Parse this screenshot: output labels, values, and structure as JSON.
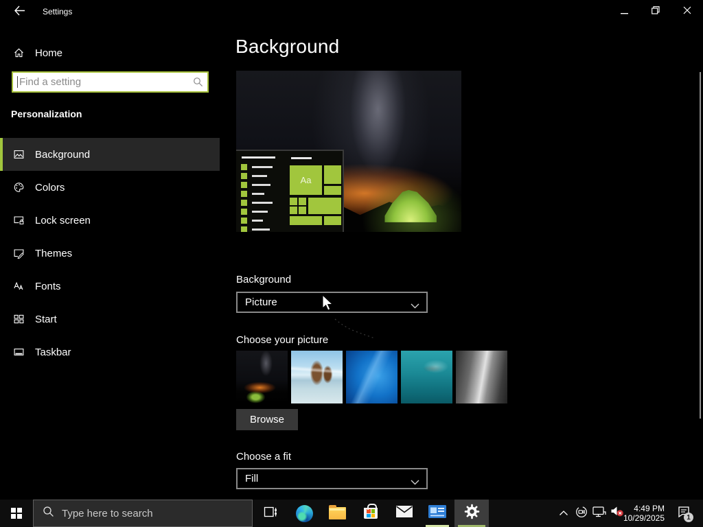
{
  "colors": {
    "accent": "#a1c63d",
    "selected_row_bg": "#272727",
    "running_underline": "#c6dc96"
  },
  "window": {
    "title": "Settings"
  },
  "sidebar": {
    "home_label": "Home",
    "search": {
      "placeholder": "Find a setting"
    },
    "section_heading": "Personalization",
    "items": [
      {
        "label": "Background",
        "selected": true
      },
      {
        "label": "Colors",
        "selected": false
      },
      {
        "label": "Lock screen",
        "selected": false
      },
      {
        "label": "Themes",
        "selected": false
      },
      {
        "label": "Fonts",
        "selected": false
      },
      {
        "label": "Start",
        "selected": false
      },
      {
        "label": "Taskbar",
        "selected": false
      }
    ]
  },
  "main": {
    "heading": "Background",
    "preview": {
      "tile_label": "Aa"
    },
    "background_section": {
      "label": "Background",
      "selected_option": "Picture"
    },
    "choose_picture": {
      "label": "Choose your picture",
      "thumbnails": [
        "night-camping-wallpaper",
        "beach-rocks-wallpaper",
        "windows-default-blue-wallpaper",
        "underwater-teal-wallpaper",
        "gray-cliff-wallpaper"
      ]
    },
    "browse_label": "Browse",
    "fit_section": {
      "label": "Choose a fit",
      "selected_option": "Fill"
    }
  },
  "taskbar": {
    "search_placeholder": "Type here to search",
    "clock": {
      "time": "4:49 PM",
      "date": "10/29/2025"
    },
    "notification_badge": "1"
  }
}
